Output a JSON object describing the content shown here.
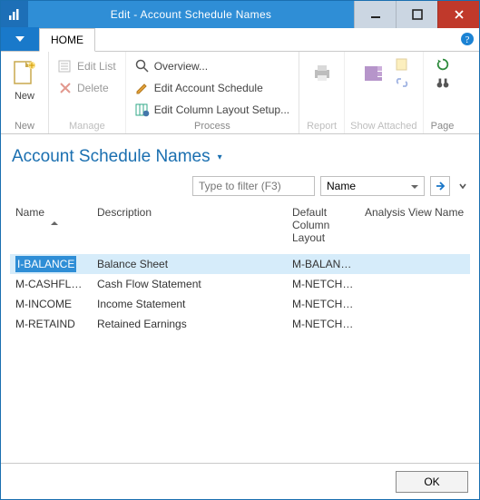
{
  "title": "Edit - Account Schedule Names",
  "tabs": {
    "file_caret": "▼",
    "home": "HOME"
  },
  "ribbon": {
    "new_group": {
      "label": "New",
      "new": "New"
    },
    "manage_group": {
      "label": "Manage",
      "edit_list": "Edit List",
      "delete": "Delete"
    },
    "process_group": {
      "label": "Process",
      "overview": "Overview...",
      "edit_schedule": "Edit Account Schedule",
      "edit_column": "Edit Column Layout Setup..."
    },
    "report_group": {
      "label": "Report"
    },
    "attached_group": {
      "label": "Show Attached"
    },
    "page_group": {
      "label": "Page"
    }
  },
  "heading": "Account Schedule Names",
  "filter": {
    "placeholder": "Type to filter (F3)",
    "field": "Name"
  },
  "columns": {
    "name": "Name",
    "description": "Description",
    "default_layout": "Default Column Layout",
    "analysis": "Analysis View Name"
  },
  "rows": [
    {
      "name": "I-BALANCE",
      "editing": true,
      "description": "Balance Sheet",
      "layout": "M-BALANCE",
      "analysis": ""
    },
    {
      "name": "M-CASHFLO...",
      "description": "Cash Flow Statement",
      "layout": "M-NETCHA...",
      "analysis": ""
    },
    {
      "name": "M-INCOME",
      "description": "Income Statement",
      "layout": "M-NETCHA...",
      "analysis": ""
    },
    {
      "name": "M-RETAIND",
      "description": "Retained Earnings",
      "layout": "M-NETCHA...",
      "analysis": ""
    }
  ],
  "footer": {
    "ok": "OK"
  }
}
